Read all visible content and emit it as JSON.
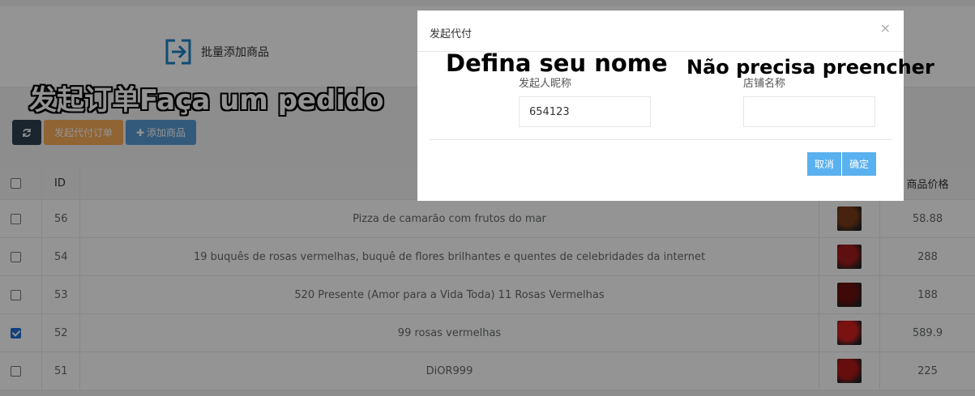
{
  "top": {
    "batch_add_label": "批量添加商品"
  },
  "caption": "发起订单Faça um pedido",
  "toolbar": {
    "refresh_icon": "refresh-icon",
    "initiate_label": "发起代付订单",
    "add_label": "添加商品"
  },
  "table": {
    "headers": {
      "id": "ID",
      "price": "商品价格"
    },
    "rows": [
      {
        "checked": false,
        "id": "56",
        "name": "Pizza de camarão com frutos do mar",
        "price": "58.88",
        "thumb_color": "#7a3b1a"
      },
      {
        "checked": false,
        "id": "54",
        "name": "19 buquês de rosas vermelhas, buquê de flores brilhantes e quentes de celebridades da internet",
        "price": "288",
        "thumb_color": "#a21a1a"
      },
      {
        "checked": false,
        "id": "53",
        "name": "520 Presente (Amor para a Vida Toda) 11 Rosas Vermelhas",
        "price": "188",
        "thumb_color": "#6a1010"
      },
      {
        "checked": true,
        "id": "52",
        "name": "99 rosas vermelhas",
        "price": "589.9",
        "thumb_color": "#d42020"
      },
      {
        "checked": false,
        "id": "51",
        "name": "DiOR999",
        "price": "225",
        "thumb_color": "#b01818"
      }
    ]
  },
  "modal": {
    "title": "发起代付",
    "close": "×",
    "nickname_label": "发起人昵称",
    "nickname_value": "654123",
    "shop_label": "店铺名称",
    "shop_value": "",
    "hint_nickname": "Defina seu nome",
    "hint_shop": "Não precisa preencher",
    "cancel_label": "取消",
    "confirm_label": "确定"
  }
}
